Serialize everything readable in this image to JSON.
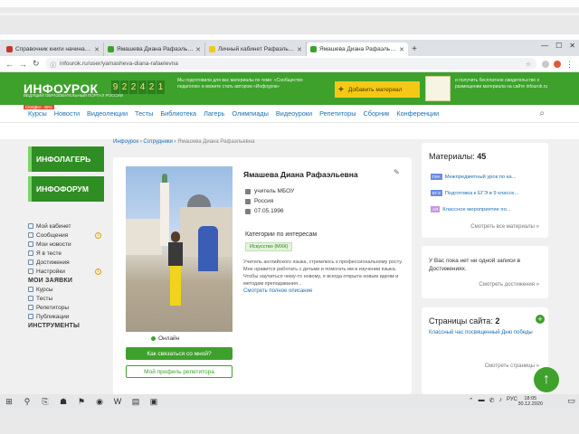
{
  "browser": {
    "tabs": [
      {
        "label": "Справочник книги начинающего",
        "color": "#c0392b",
        "active": false
      },
      {
        "label": "Ямашева Диана Рафаэльевна",
        "color": "#3ea12c",
        "active": false
      },
      {
        "label": "Личный кабинет Рафаэльевна",
        "color": "#f5c816",
        "active": false
      },
      {
        "label": "Ямашева Диана Рафаэльевна",
        "color": "#3ea12c",
        "active": true
      }
    ],
    "new_tab": "+",
    "window_controls": [
      "—",
      "☐",
      "✕"
    ],
    "url": "infourok.ru/user/yamasheva-diana-rafaelevna"
  },
  "header": {
    "logo": "ИНФОУРОК",
    "logo_sub": "ВЕДУЩИЙ ОБРАЗОВАТЕЛЬНЫЙ ПОРТАЛ РОССИИ",
    "counter": [
      "9",
      "2",
      "2",
      "4",
      "2",
      "1"
    ],
    "text_left": "Мы подготовили для вас материалы по теме: «Сообщество педагогов» и можете стать автором «Инфоурок»",
    "add_material": "Добавить материал",
    "add_icon": "+",
    "text_right": "и получить бесплатное свидетельство о размещении материала на сайте infourok.ru",
    "badge": "СКИДКА -45%"
  },
  "nav": {
    "items": [
      "Курсы",
      "Новости",
      "Видеолекции",
      "Тесты",
      "Библиотека",
      "Лагерь",
      "Олимпиады",
      "Видеоуроки",
      "Репетиторы",
      "Сборник",
      "Конференции"
    ],
    "search_icon": "⌕"
  },
  "sidebar": {
    "banners": [
      "ИНФОЛАГЕРЬ",
      "ИНФОФОРУМ"
    ],
    "items": [
      {
        "label": "Мой кабинет",
        "count": ""
      },
      {
        "label": "Сообщения",
        "count": "1"
      },
      {
        "label": "Мои новости",
        "count": ""
      },
      {
        "label": "Я в тесте",
        "count": ""
      },
      {
        "label": "Достижения",
        "count": ""
      },
      {
        "label": "Настройки",
        "count": "1"
      }
    ],
    "section_orders": "МОИ ЗАЯВКИ",
    "orders": [
      {
        "label": "Курсы"
      },
      {
        "label": "Тесты"
      },
      {
        "label": "Репетиторы"
      },
      {
        "label": "Публикации"
      }
    ],
    "section_tools": "ИНСТРУМЕНТЫ"
  },
  "breadcrumbs": {
    "path": "Инфоурок › Сотрудники › ",
    "current": "Ямашева Диана Рафаэльевна"
  },
  "profile": {
    "name": "Ямашева Диана Рафаэльевна",
    "edit_icon": "✎",
    "rows": [
      "учитель МБОУ",
      "Россия",
      "07.05.1996"
    ],
    "categories_title": "Категории по интересам",
    "category": "Искусство (МХК)",
    "bio": "Учитель английского языка, стремлюсь к профессиональному росту. Мне нравится работать с детьми и помогать им в изучении языка. Чтобы научиться чему-то новому, я всегда открыта новым идеям и методам преподавания...",
    "bio_link": "Смотреть полное описание",
    "status": "Онлайн",
    "btn_primary": "Как связаться со мной?",
    "btn_secondary": "Мой профиль репетитора"
  },
  "right": {
    "materials_title": "Материалы:",
    "materials_count": "45",
    "materials": [
      {
        "tag": "ГИА",
        "color": "#6a8de0",
        "text": "Межпредметный урок по ка..."
      },
      {
        "tag": "ЕГЭ",
        "color": "#6a8de0",
        "text": "Подготовка к ЕГЭ в 9 классе..."
      },
      {
        "tag": "АЯ",
        "color": "#c79ae0",
        "text": "Классное мероприятие по..."
      }
    ],
    "materials_link": "Смотреть все материалы »",
    "achievements_text": "У Вас пока нет ни одной записи в Достижениях.",
    "achievements_link": "Смотреть достижения »",
    "pages_title": "Страницы сайта:",
    "pages_count": "2",
    "add_icon": "+",
    "pages_item": "Классный час посвященный Дню победы",
    "pages_link": "Смотреть страницы »",
    "up_icon": "↑"
  },
  "taskbar": {
    "icons": [
      "⊞",
      "⚲",
      "⎘",
      "☗",
      "⚑",
      "◉",
      "W",
      "▤",
      "▣"
    ],
    "tray": [
      "⌃",
      "▬",
      "✆",
      "♪"
    ],
    "lang": "РУС",
    "time": "18:05",
    "date": "30.12.2020",
    "notif_icon": "▭"
  }
}
